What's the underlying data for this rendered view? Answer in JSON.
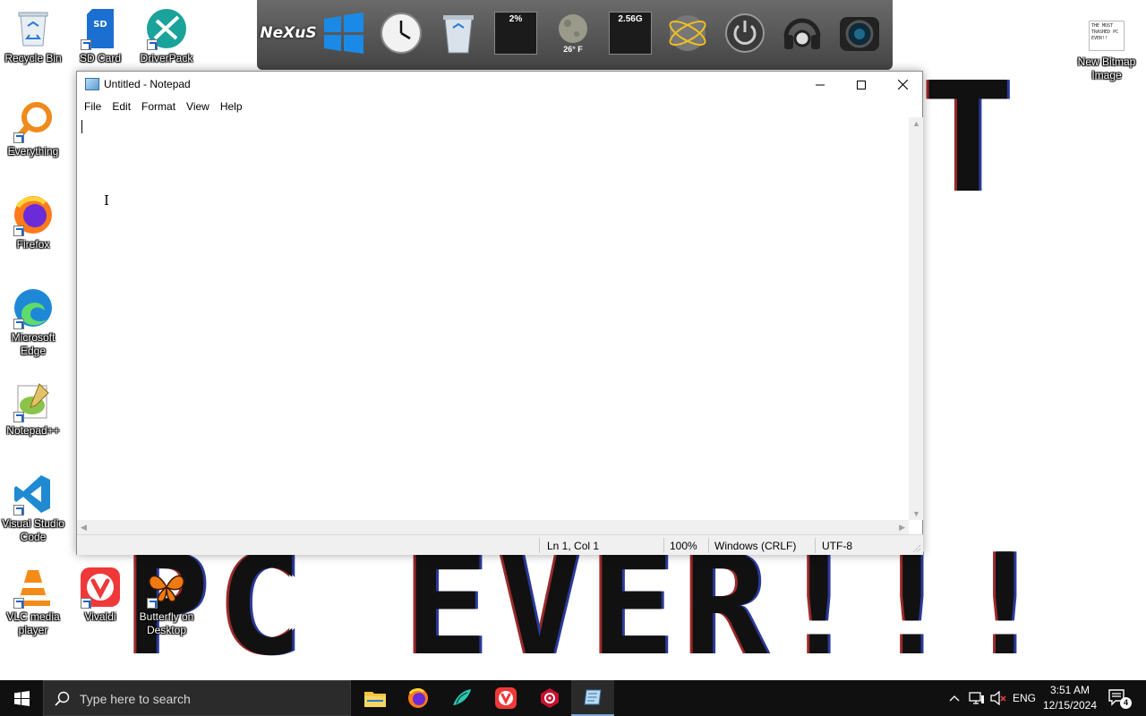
{
  "wallpaper": {
    "bottom_text": "PC EVER!!!",
    "top_text": "T"
  },
  "desktop_icons": [
    {
      "label": "Recycle Bin"
    },
    {
      "label": "SD Card"
    },
    {
      "label": "DriverPack"
    },
    {
      "label": "Everything"
    },
    {
      "label": "Firefox"
    },
    {
      "label": "Microsoft Edge"
    },
    {
      "label": "Notepad++"
    },
    {
      "label": "Visual Studio Code"
    },
    {
      "label": "VLC media player"
    },
    {
      "label": "Vivaldi"
    },
    {
      "label": "Butterfly on Desktop"
    },
    {
      "label": "New Bitmap Image"
    }
  ],
  "bitmap_thumb_text": "THE MOST TRASHED PC EVER!!",
  "dock": {
    "logo": "NeXuS",
    "cpu_label": "2%",
    "weather_label": "26° F",
    "mem_label": "2.56G"
  },
  "notepad": {
    "title": "Untitled - Notepad",
    "menu": [
      "File",
      "Edit",
      "Format",
      "View",
      "Help"
    ],
    "content": "",
    "status": {
      "position": "Ln 1, Col 1",
      "zoom": "100%",
      "line_ending": "Windows (CRLF)",
      "encoding": "UTF-8"
    }
  },
  "taskbar": {
    "search_placeholder": "Type here to search",
    "language": "ENG",
    "time": "3:51 AM",
    "date": "12/15/2024",
    "notification_count": "4"
  },
  "colors": {
    "taskbar_bg": "#101010",
    "windows_blue": "#1a8ae6",
    "vivaldi_red": "#ef3939"
  }
}
